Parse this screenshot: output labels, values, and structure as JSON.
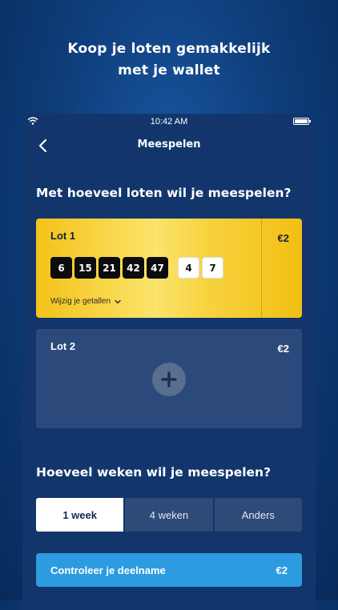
{
  "headline": {
    "line1": "Koop je loten gemakkelijk",
    "line2": "met je wallet"
  },
  "status_bar": {
    "time": "10:42 AM"
  },
  "nav": {
    "title": "Meespelen",
    "back_icon": "chevron-left-icon"
  },
  "lots_section": {
    "title": "Met hoeveel loten wil je meespelen?"
  },
  "lots": [
    {
      "label": "Lot 1",
      "price": "€2",
      "main_numbers": [
        "6",
        "15",
        "21",
        "42",
        "47"
      ],
      "extra_numbers": [
        "4",
        "7"
      ],
      "change_label": "Wijzig je getallen",
      "card_color": "#f5c518"
    },
    {
      "label": "Lot 2",
      "price": "€2",
      "add_icon": "plus-icon"
    }
  ],
  "weeks_section": {
    "title": "Hoeveel weken wil je meespelen?",
    "options": [
      "1 week",
      "4 weken",
      "Anders"
    ],
    "selected": "1 week"
  },
  "cta": {
    "label": "Controleer je deelname",
    "price": "€2",
    "color": "#2c9be0"
  }
}
